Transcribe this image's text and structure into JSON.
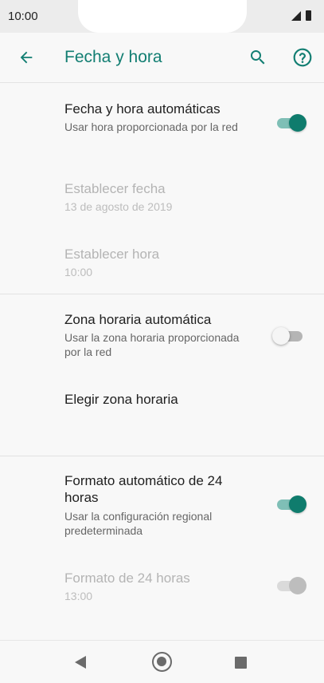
{
  "status_bar": {
    "time": "10:00"
  },
  "app_bar": {
    "title": "Fecha y hora"
  },
  "settings": {
    "auto_datetime": {
      "title": "Fecha y hora automáticas",
      "subtitle": "Usar hora proporcionada por la red",
      "enabled": true,
      "checked": true
    },
    "set_date": {
      "title": "Establecer fecha",
      "subtitle": "13 de agosto de 2019",
      "enabled": false
    },
    "set_time": {
      "title": "Establecer hora",
      "subtitle": "10:00",
      "enabled": false
    },
    "auto_timezone": {
      "title": "Zona horaria automática",
      "subtitle": "Usar la zona horaria proporcionada por la red",
      "enabled": true,
      "checked": false
    },
    "choose_timezone": {
      "title": "Elegir zona horaria",
      "enabled": true
    },
    "auto_24h": {
      "title": "Formato automático de 24 horas",
      "subtitle": "Usar la configuración regional predeterminada",
      "enabled": true,
      "checked": true
    },
    "format_24h": {
      "title": "Formato de 24 horas",
      "subtitle": "13:00",
      "enabled": false,
      "checked": true
    }
  },
  "colors": {
    "accent": "#127e72",
    "switch_on_thumb": "#0f7c6d",
    "switch_on_track": "#7fbfb6"
  },
  "icons": {
    "back": "arrow-left-icon",
    "search": "search-icon",
    "help": "help-circle-icon"
  }
}
